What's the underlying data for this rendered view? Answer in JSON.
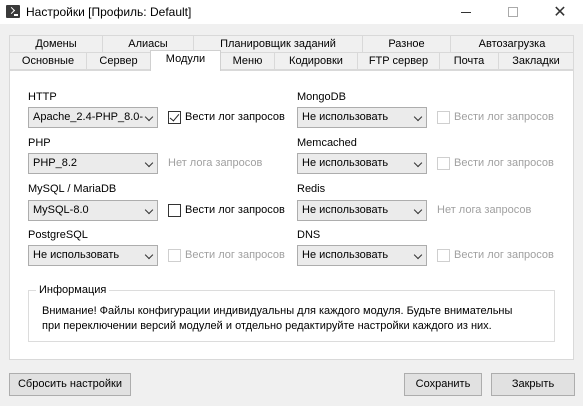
{
  "window": {
    "title": "Настройки [Профиль: Default]"
  },
  "tabs_row1": [
    "Домены",
    "Алиасы",
    "Планировщик заданий",
    "Разное",
    "Автозагрузка"
  ],
  "tabs_row2": [
    "Основные",
    "Сервер",
    "Модули",
    "Меню",
    "Кодировки",
    "FTP сервер",
    "Почта",
    "Закладки"
  ],
  "active_tab": "Модули",
  "modules": {
    "http": {
      "label": "HTTP",
      "value": "Apache_2.4-PHP_8.0-",
      "log_label": "Вести лог запросов",
      "log_checked": true
    },
    "php": {
      "label": "PHP",
      "value": "PHP_8.2",
      "log_label": "Нет лога запросов"
    },
    "mysql": {
      "label": "MySQL / MariaDB",
      "value": "MySQL-8.0",
      "log_label": "Вести лог запросов",
      "log_checked": false
    },
    "postgres": {
      "label": "PostgreSQL",
      "value": "Не использовать",
      "log_label": "Вести лог запросов",
      "log_checked": false
    },
    "mongodb": {
      "label": "MongoDB",
      "value": "Не использовать",
      "log_label": "Вести лог запросов",
      "log_checked": false
    },
    "memcached": {
      "label": "Memcached",
      "value": "Не использовать",
      "log_label": "Вести лог запросов",
      "log_checked": false
    },
    "redis": {
      "label": "Redis",
      "value": "Не использовать",
      "log_label": "Нет лога запросов"
    },
    "dns": {
      "label": "DNS",
      "value": "Не использовать",
      "log_label": "Вести лог запросов",
      "log_checked": false
    }
  },
  "info": {
    "title": "Информация",
    "line1": "Внимание! Файлы конфигурации индивидуальны для каждого модуля. Будьте внимательны",
    "line2": "при переключении версий модулей и отдельно редактируйте настройки каждого из них."
  },
  "buttons": {
    "reset": "Сбросить настройки",
    "save": "Сохранить",
    "close": "Закрыть"
  }
}
